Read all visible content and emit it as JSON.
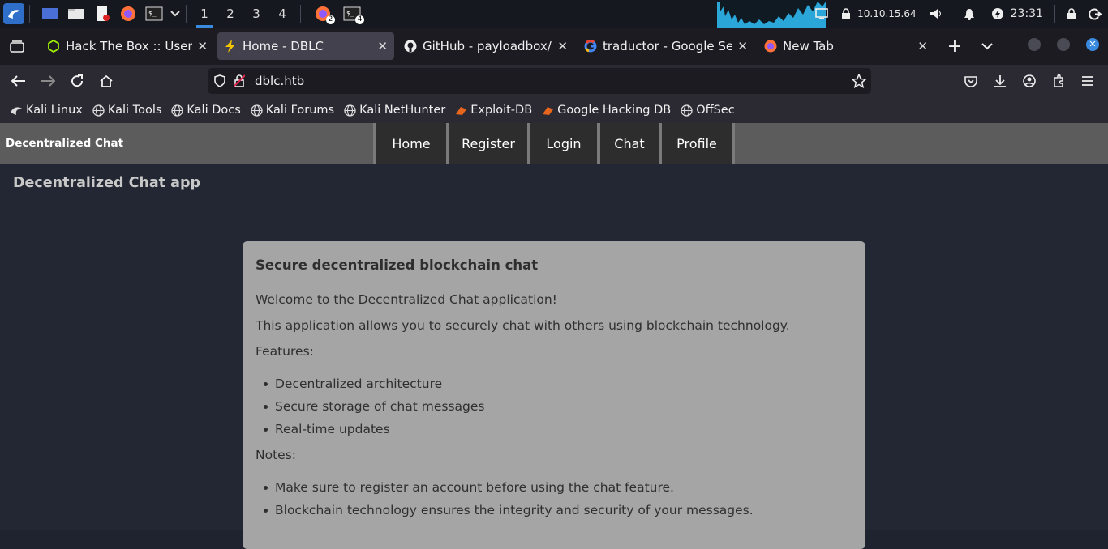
{
  "taskbar": {
    "workspaces": [
      "1",
      "2",
      "3",
      "4"
    ],
    "firefox_badge": "2",
    "terminal_badge": "4",
    "ip": "10.10.15.64",
    "time": "23:31"
  },
  "tabs": [
    {
      "title": "Hack The Box :: User Profile",
      "icon": "htb-cube-icon"
    },
    {
      "title": "Home - DBLC",
      "icon": "lightning-icon"
    },
    {
      "title": "GitHub - payloadbox/xss-payload-list",
      "icon": "github-icon"
    },
    {
      "title": "traductor - Google Search",
      "icon": "google-icon"
    },
    {
      "title": "New Tab",
      "icon": "firefox-icon"
    }
  ],
  "url": "dblc.htb",
  "bookmarks": [
    "Kali Linux",
    "Kali Tools",
    "Kali Docs",
    "Kali Forums",
    "Kali NetHunter",
    "Exploit-DB",
    "Google Hacking DB",
    "OffSec"
  ],
  "site": {
    "brand": "Decentralized Chat",
    "nav": [
      "Home",
      "Register",
      "Login",
      "Chat",
      "Profile"
    ],
    "app_title": "Decentralized Chat app",
    "card": {
      "heading": "Secure decentralized blockchain chat",
      "welcome": "Welcome to the Decentralized Chat application!",
      "description": "This application allows you to securely chat with others using blockchain technology.",
      "features_label": "Features:",
      "features": [
        "Decentralized architecture",
        "Secure storage of chat messages",
        "Real-time updates"
      ],
      "notes_label": "Notes:",
      "notes": [
        "Make sure to register an account before using the chat feature.",
        "Blockchain technology ensures the integrity and security of your messages."
      ]
    }
  },
  "colors": {
    "accent": "#3a8be0",
    "card_bg": "#a5a5a5",
    "nav_bg": "#5c5c5c"
  }
}
